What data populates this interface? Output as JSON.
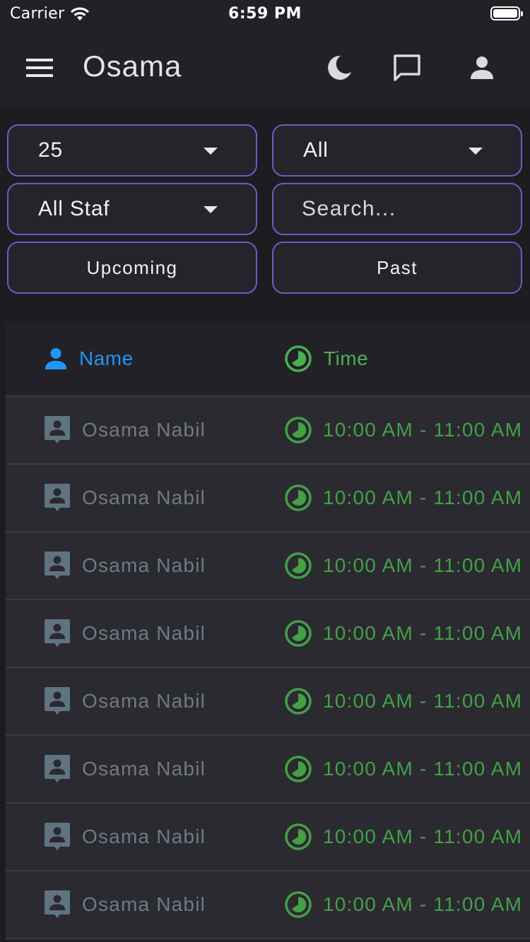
{
  "status_bar": {
    "carrier": "Carrier",
    "time": "6:59 PM"
  },
  "app_bar": {
    "title": "Osama",
    "icons": [
      "menu-icon",
      "moon-icon",
      "chat-icon",
      "person-icon"
    ]
  },
  "filters": {
    "page_size": "25",
    "category": "All",
    "staff": "All Staf",
    "search_placeholder": "Search...",
    "search_value": "",
    "upcoming_label": "Upcoming",
    "past_label": "Past"
  },
  "table": {
    "columns": [
      {
        "label": "Name",
        "icon": "person-icon",
        "color": "#2196f3"
      },
      {
        "label": "Time",
        "icon": "clock-icon",
        "color": "#4caf50"
      }
    ],
    "rows": [
      {
        "name": "Osama Nabil",
        "time": "10:00 AM - 11:00 AM"
      },
      {
        "name": "Osama Nabil",
        "time": "10:00 AM - 11:00 AM"
      },
      {
        "name": "Osama Nabil",
        "time": "10:00 AM - 11:00 AM"
      },
      {
        "name": "Osama Nabil",
        "time": "10:00 AM - 11:00 AM"
      },
      {
        "name": "Osama Nabil",
        "time": "10:00 AM - 11:00 AM"
      },
      {
        "name": "Osama Nabil",
        "time": "10:00 AM - 11:00 AM"
      },
      {
        "name": "Osama Nabil",
        "time": "10:00 AM - 11:00 AM"
      },
      {
        "name": "Osama Nabil",
        "time": "10:00 AM - 11:00 AM"
      }
    ]
  },
  "colors": {
    "accent_border": "#6e5bc4",
    "name_header": "#2196f3",
    "time_green": "#4caf50",
    "name_text": "#6c7b85"
  }
}
